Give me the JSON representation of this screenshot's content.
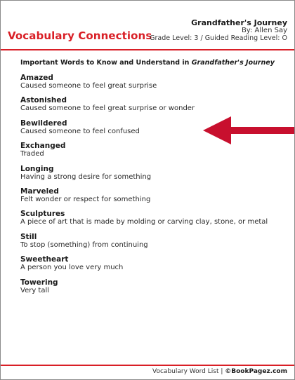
{
  "header": {
    "title": "Vocabulary Connections",
    "book_title": "Grandfather's Journey",
    "author": "By: Allen Say",
    "grade_level": "Grade Level: 3 / Guided Reading Level: O"
  },
  "intro": {
    "prefix": "Important Words to Know and Understand in ",
    "book": "Grandfather's Journey"
  },
  "vocabulary": [
    {
      "word": "Amazed",
      "definition": "Caused someone to feel great surprise"
    },
    {
      "word": "Astonished",
      "definition": "Caused someone to feel great surprise or wonder"
    },
    {
      "word": "Bewildered",
      "definition": "Caused someone to feel confused"
    },
    {
      "word": "Exchanged",
      "definition": "Traded"
    },
    {
      "word": "Longing",
      "definition": "Having a strong desire for something"
    },
    {
      "word": "Marveled",
      "definition": "Felt wonder or respect for something"
    },
    {
      "word": "Sculptures",
      "definition": "A piece of art that is made by molding or carving clay, stone, or metal"
    },
    {
      "word": "Still",
      "definition": "To stop (something) from continuing"
    },
    {
      "word": "Sweetheart",
      "definition": "A person you love very much"
    },
    {
      "word": "Towering",
      "definition": "Very tall"
    }
  ],
  "footer": {
    "label": "Vocabulary Word List | ",
    "brand": "©BookPagez.com"
  },
  "colors": {
    "accent": "#d91f26",
    "arrow": "#c8102e"
  },
  "icons": {
    "arrow": "left-arrow-icon"
  }
}
